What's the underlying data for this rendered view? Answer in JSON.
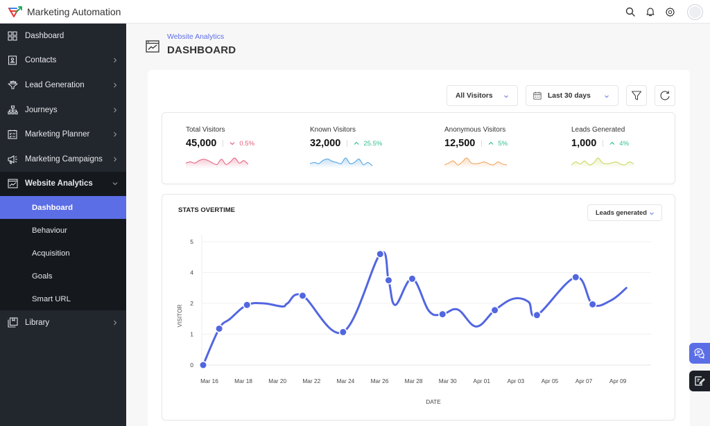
{
  "app": {
    "title": "Marketing Automation",
    "icons": [
      "search-icon",
      "bell-icon",
      "gear-icon",
      "avatar"
    ]
  },
  "sidebar": {
    "items": [
      {
        "label": "Dashboard",
        "icon": "grid-icon",
        "has_chevron": false
      },
      {
        "label": "Contacts",
        "icon": "contact-card-icon",
        "has_chevron": true
      },
      {
        "label": "Lead Generation",
        "icon": "funnel-icon",
        "has_chevron": true
      },
      {
        "label": "Journeys",
        "icon": "hierarchy-icon",
        "has_chevron": true
      },
      {
        "label": "Marketing Planner",
        "icon": "planner-icon",
        "has_chevron": true
      },
      {
        "label": "Marketing Campaigns",
        "icon": "megaphone-icon",
        "has_chevron": true
      },
      {
        "label": "Website Analytics",
        "icon": "analytics-icon",
        "has_chevron": true,
        "expanded": true
      },
      {
        "label": "Library",
        "icon": "library-icon",
        "has_chevron": true
      }
    ],
    "submenu": [
      {
        "label": "Dashboard",
        "active": true
      },
      {
        "label": "Behaviour",
        "active": false
      },
      {
        "label": "Acquisition",
        "active": false
      },
      {
        "label": "Goals",
        "active": false
      },
      {
        "label": "Smart URL",
        "active": false
      }
    ]
  },
  "page": {
    "breadcrumb": "Website Analytics",
    "title": "DASHBOARD"
  },
  "filters": {
    "visitors": "All Visitors",
    "date_range": "Last 30 days",
    "filter_icon": "filter-icon",
    "refresh_icon": "refresh-icon"
  },
  "kpis": [
    {
      "label": "Total Visitors",
      "value": "45,000",
      "delta": "0.5%",
      "direction": "down",
      "color": "#e45b7a",
      "spark": [
        3,
        4,
        3,
        5,
        6,
        5,
        3,
        2,
        6,
        2,
        4,
        7,
        3,
        5,
        2
      ]
    },
    {
      "label": "Known Visitors",
      "value": "32,000",
      "delta": "25.5%",
      "direction": "up",
      "color": "#4a9fe0",
      "spark": [
        3,
        4,
        3,
        6,
        7,
        5,
        4,
        3,
        8,
        3,
        4,
        7,
        2,
        4,
        1
      ]
    },
    {
      "label": "Anonymous Visitors",
      "value": "12,500",
      "delta": "5%",
      "direction": "up",
      "color": "#f0a057",
      "spark": [
        2,
        4,
        6,
        2,
        5,
        9,
        4,
        3,
        4,
        5,
        3,
        2,
        5,
        3,
        2
      ]
    },
    {
      "label": "Leads Generated",
      "value": "1,000",
      "delta": "4%",
      "direction": "up",
      "color": "#c8d65a",
      "spark": [
        2,
        5,
        3,
        6,
        2,
        4,
        9,
        4,
        3,
        4,
        5,
        3,
        2,
        5,
        3
      ]
    }
  ],
  "delta_colors": {
    "up": "#2fbf8f",
    "down": "#e45b7a"
  },
  "chart_section": {
    "title": "STATS OVERTIME",
    "metric_select": "Leads generated"
  },
  "floating": {
    "chat_icon": "chat-icon",
    "note_icon": "edit-note-icon",
    "chat_color": "#5c6ee6"
  },
  "chart_data": {
    "type": "line",
    "title": "STATS OVERTIME",
    "xlabel": "DATE",
    "ylabel": "VISITOR",
    "ytick_labels": [
      "0",
      "1",
      "2",
      "4",
      "5"
    ],
    "ylim": [
      0,
      4
    ],
    "xticks": [
      "Mar 16",
      "Mar 18",
      "Mar 20",
      "Mar 22",
      "Mar 24",
      "Mar 26",
      "Mar 28",
      "Mar 30",
      "Apr 01",
      "Apr 03",
      "Apr 05",
      "Apr 07",
      "Apr 09"
    ],
    "x_day_range": [
      0,
      25.5
    ],
    "grid": true,
    "color": "#5266e0",
    "series": [
      {
        "name": "Leads generated",
        "points": [
          {
            "day": 0,
            "value": 0,
            "marker": true
          },
          {
            "day": 0.95,
            "value": 1.18,
            "marker": true
          },
          {
            "day": 1.6,
            "value": 1.5,
            "marker": false
          },
          {
            "day": 2.6,
            "value": 1.95,
            "marker": true
          },
          {
            "day": 3.6,
            "value": 2.0,
            "marker": false
          },
          {
            "day": 4.7,
            "value": 1.9,
            "marker": false
          },
          {
            "day": 5.0,
            "value": 2.0,
            "marker": false
          },
          {
            "day": 5.9,
            "value": 2.25,
            "marker": true
          },
          {
            "day": 8.3,
            "value": 1.07,
            "marker": true
          },
          {
            "day": 10.5,
            "value": 3.6,
            "marker": true
          },
          {
            "day": 11.0,
            "value": 2.75,
            "marker": true
          },
          {
            "day": 11.4,
            "value": 1.95,
            "marker": false
          },
          {
            "day": 12.4,
            "value": 2.8,
            "marker": true
          },
          {
            "day": 13.4,
            "value": 1.75,
            "marker": false
          },
          {
            "day": 14.2,
            "value": 1.65,
            "marker": true
          },
          {
            "day": 15.1,
            "value": 1.8,
            "marker": false
          },
          {
            "day": 16.2,
            "value": 1.25,
            "marker": false
          },
          {
            "day": 17.3,
            "value": 1.78,
            "marker": true
          },
          {
            "day": 18.4,
            "value": 2.15,
            "marker": false
          },
          {
            "day": 19.3,
            "value": 2.05,
            "marker": false
          },
          {
            "day": 19.8,
            "value": 1.62,
            "marker": true
          },
          {
            "day": 22.1,
            "value": 2.85,
            "marker": true
          },
          {
            "day": 23.1,
            "value": 1.97,
            "marker": true
          },
          {
            "day": 24.2,
            "value": 2.1,
            "marker": false
          },
          {
            "day": 25.1,
            "value": 2.5,
            "marker": false
          }
        ]
      }
    ]
  }
}
